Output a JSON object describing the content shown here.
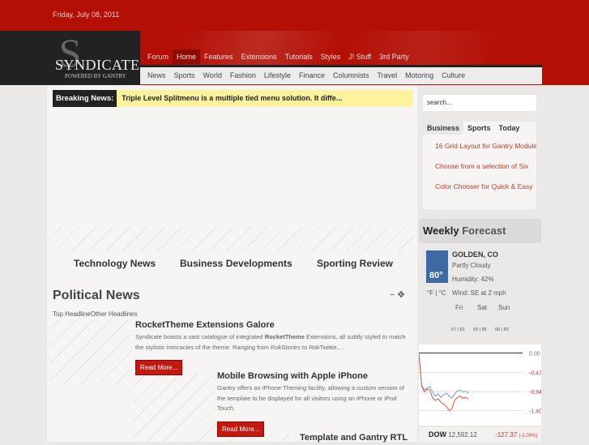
{
  "date": "Friday, July 08, 2011",
  "logo": {
    "letter": "S",
    "name": "SYNDICATE",
    "tagline": "POWERED BY GANTRY"
  },
  "nav_main": [
    "Forum",
    "Home",
    "Features",
    "Extensions",
    "Tutorials",
    "Styles",
    "J! Stuff",
    "3rd Party"
  ],
  "nav_active": "Home",
  "nav_sub": [
    "News",
    "Sports",
    "World",
    "Fashion",
    "Lifestyle",
    "Finance",
    "Columnists",
    "Travel",
    "Motoring",
    "Culture"
  ],
  "breaking": {
    "label": "Breaking News:",
    "text": "Triple Level Splitmenu is a multiple tied menu solution. It diffe..."
  },
  "features": [
    "Technology News",
    "Business Developments",
    "Sporting Review"
  ],
  "political": {
    "title": "Political News",
    "controls": "− ✥",
    "tabs": "Top HeadlineOther Headlines",
    "articles": [
      {
        "title": "RocketTheme Extensions Galore",
        "pre": "Syndicate boasts a vast catalogue of integrated ",
        "bold": "RocketTheme",
        "post": " Extensions, all subtly styled to match the stylistic intricacies of the theme. Ranging from RokStories to RokTwittie,...",
        "button": "Read More..."
      },
      {
        "title": "Mobile Browsing with Apple iPhone",
        "pre": "Gantry offers an iPhone Theming facility, allowing a custom version of the template to be displayed for all visitors using an iPhone or iPod Touch.",
        "bold": "",
        "post": "",
        "button": "Read More..."
      },
      {
        "title": "Template and Gantry RTL"
      }
    ]
  },
  "search": {
    "placeholder": "search..."
  },
  "tabs": {
    "labels": [
      "Business",
      "Sports",
      "Today"
    ],
    "active": "Business",
    "items": [
      "16 Grid Layout for Gantry Modules",
      "Choose from a selection of Six",
      "Color Chooser for Quick & Easy"
    ]
  },
  "weather": {
    "title_a": "Weekly",
    "title_b": "Forecast",
    "city": "GOLDEN, CO",
    "temp": "80°",
    "cond": "Partly Cloudy",
    "humidity": "Humidity: 42%",
    "wind": "Wind: SE at 2 mph",
    "units": "°F | °C",
    "days": [
      {
        "d": "Fri",
        "t": "57 | 81"
      },
      {
        "d": "Sat",
        "t": "59 | 85"
      },
      {
        "d": "Sun",
        "t": "58 | 83"
      }
    ]
  },
  "stock": {
    "index": "DOW",
    "value": "12,592.12",
    "change": "-127.37",
    "pct": "(-1.00%)",
    "colors": {
      "a": "#6fa0f0",
      "b": "#e0573a"
    }
  },
  "chart_data": {
    "type": "line",
    "ylim": [
      -1.6,
      0.05
    ],
    "yticks": [
      "0.00",
      "-0.47",
      "-0.94",
      "-1.40"
    ],
    "series": [
      {
        "values": [
          0,
          -0.78,
          -0.9,
          -0.85,
          -0.82,
          -0.95,
          -1.05,
          -1.0,
          -1.08,
          -1.02,
          -0.98,
          -1.05,
          -1.1,
          -1.0,
          -0.92,
          -0.9,
          -0.95,
          -0.93,
          -0.98
        ]
      },
      {
        "values": [
          0,
          -0.8,
          -0.95,
          -0.88,
          -0.9,
          -1.1,
          -1.15,
          -1.12,
          -1.2,
          -1.25,
          -1.3,
          -1.4,
          -1.35,
          -1.15,
          -1.08,
          -1.05,
          -1.1,
          -1.08,
          -1.12
        ]
      }
    ]
  }
}
